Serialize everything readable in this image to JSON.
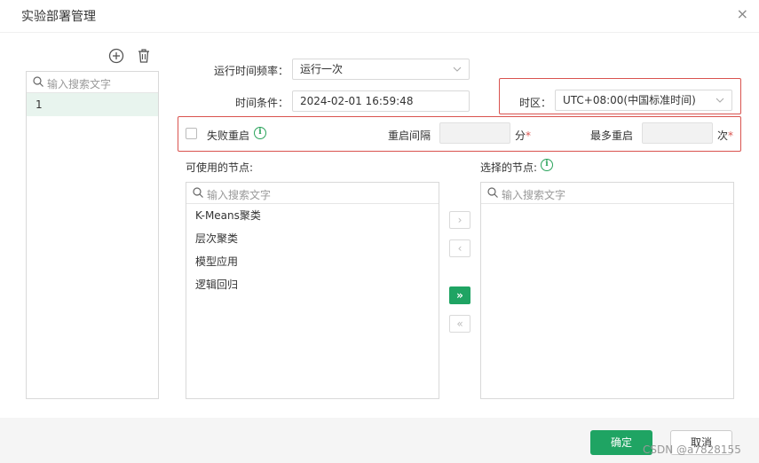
{
  "dialog": {
    "title": "实验部署管理",
    "close_glyph": "×"
  },
  "left": {
    "search_placeholder": "输入搜索文字",
    "items": [
      "1"
    ]
  },
  "form": {
    "freq_label": "运行时间频率：",
    "freq_value": "运行一次",
    "time_label": "时间条件：",
    "time_value": "2024-02-01 16:59:48",
    "tz_label": "时区：",
    "tz_value": "UTC+08:00(中国标准时间)"
  },
  "retry": {
    "fail_restart_label": "失败重启",
    "interval_label": "重启间隔",
    "interval_unit": "分",
    "max_label": "最多重启",
    "max_unit": "次",
    "required_mark": "*"
  },
  "available": {
    "title": "可使用的节点:",
    "search_placeholder": "输入搜索文字",
    "items": [
      "K-Means聚类",
      "层次聚类",
      "模型应用",
      "逻辑回归"
    ]
  },
  "selected": {
    "title": "选择的节点:",
    "search_placeholder": "输入搜索文字"
  },
  "transfer": {
    "move_right": "›",
    "move_left": "‹",
    "move_all_right": "»",
    "move_all_left": "«"
  },
  "footer": {
    "ok_label": "确定",
    "cancel_label": "取消"
  },
  "watermark": "CSDN @a7828155",
  "colors": {
    "accent": "#1fa463",
    "alert_border": "#d9534f",
    "selected_row": "#e8f4ee"
  }
}
